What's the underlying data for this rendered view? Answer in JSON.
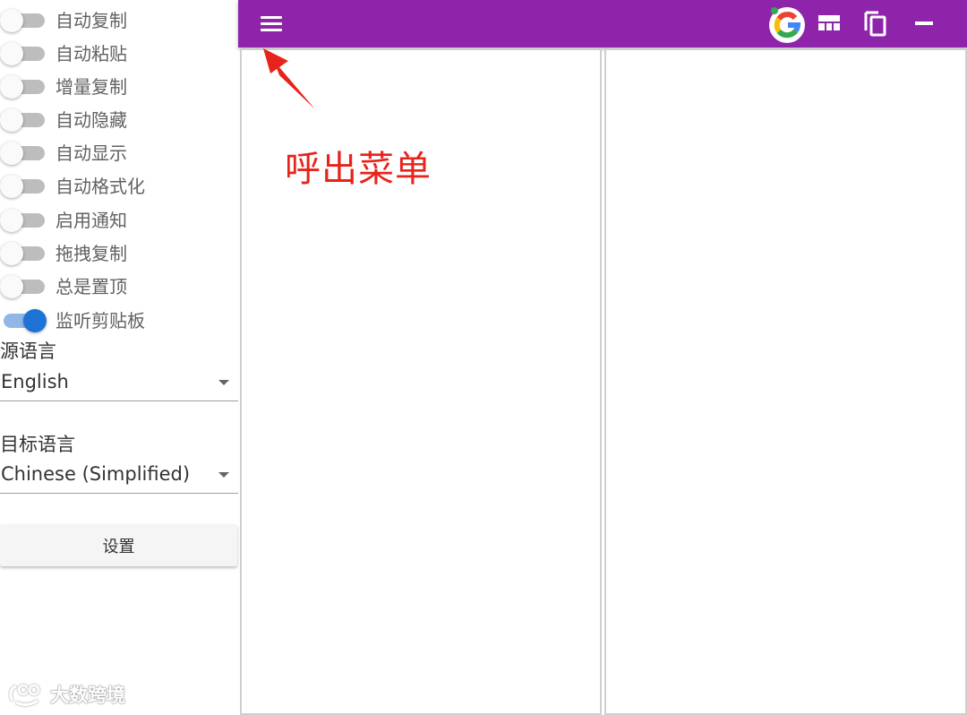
{
  "sidebar": {
    "toggles": [
      {
        "label": "自动复制",
        "on": false
      },
      {
        "label": "自动粘贴",
        "on": false
      },
      {
        "label": "增量复制",
        "on": false
      },
      {
        "label": "自动隐藏",
        "on": false
      },
      {
        "label": "自动显示",
        "on": false
      },
      {
        "label": "自动格式化",
        "on": false
      },
      {
        "label": "启用通知",
        "on": false
      },
      {
        "label": "拖拽复制",
        "on": false
      },
      {
        "label": "总是置顶",
        "on": false
      },
      {
        "label": "监听剪贴板",
        "on": true
      }
    ],
    "source_language": {
      "label": "源语言",
      "value": "English"
    },
    "target_language": {
      "label": "目标语言",
      "value": "Chinese (Simplified)"
    },
    "settings_label": "设置",
    "watermark_text": "大数跨境"
  },
  "topbar": {
    "color": "#8e24aa",
    "icons": [
      "menu-icon",
      "google-icon",
      "layout-icon",
      "copy-icon",
      "minimize-icon"
    ]
  },
  "annotation": {
    "text": "呼出菜单",
    "color": "#e8231b"
  },
  "colors": {
    "switch_on": "#1e72d6",
    "switch_off": "#bdbdbd"
  }
}
